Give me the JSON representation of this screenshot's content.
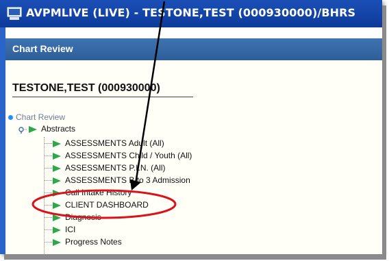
{
  "window": {
    "title": "AVPMLIVE (LIVE) - TESTONE,TEST (000930000)/BHRS"
  },
  "panel": {
    "header": "Chart Review"
  },
  "patient": {
    "name_id": "TESTONE,TEST (000930000)"
  },
  "tree": {
    "root_label": "Chart Review",
    "group_label": "Abstracts",
    "items": [
      {
        "label": "ASSESSMENTS Adult (All)"
      },
      {
        "label": "ASSESSMENTS Child / Youth (All)"
      },
      {
        "label": "ASSESSMENTS P.I.N. (All)"
      },
      {
        "label": "ASSESSMENTS B to 3 Admission"
      },
      {
        "label": "Call Intake History"
      },
      {
        "label": "CLIENT DASHBOARD"
      },
      {
        "label": "Diagnosis"
      },
      {
        "label": "ICI"
      },
      {
        "label": "Progress Notes"
      }
    ]
  },
  "colors": {
    "titlebar": "#1b4fb6",
    "panel_header": "#3f74b0",
    "annotation_red": "#d9121b",
    "tree_arrow": "#2aa84a"
  }
}
